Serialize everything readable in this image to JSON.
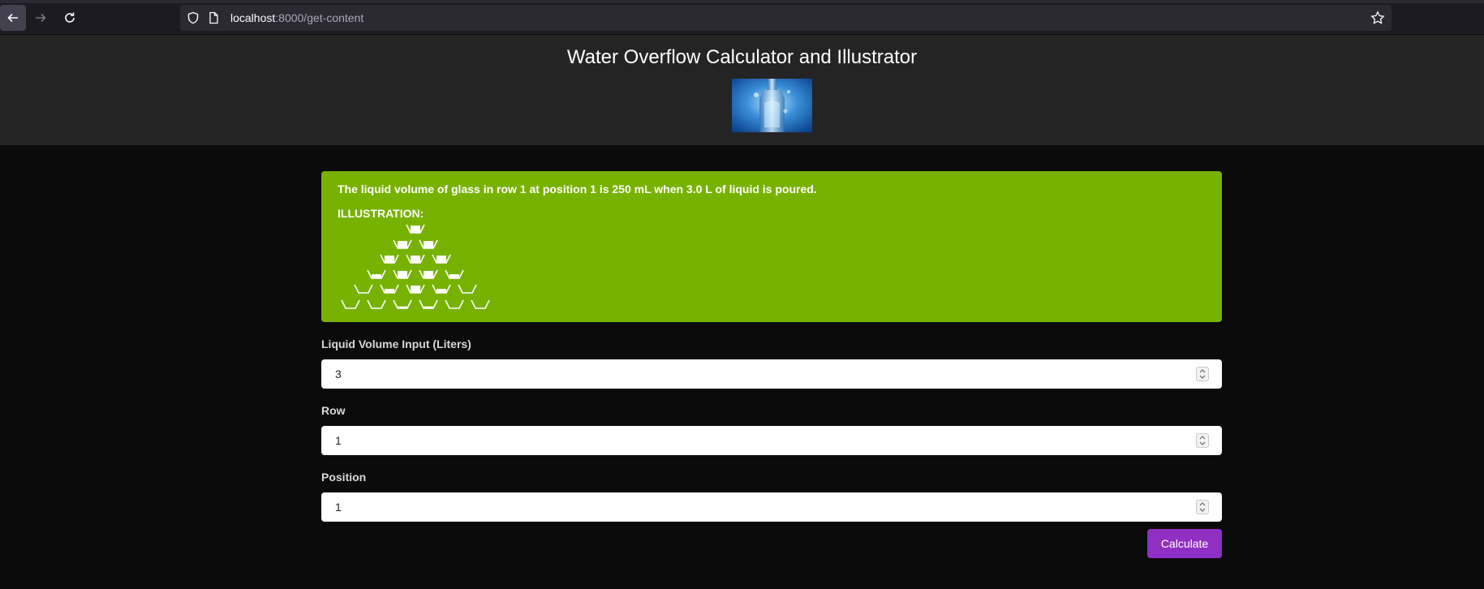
{
  "browser": {
    "url_host": "localhost",
    "url_rest": ":8000/get-content"
  },
  "header": {
    "title": "Water Overflow Calculator and Illustrator"
  },
  "result": {
    "message": "The liquid volume of glass in row 1 at position 1 is 250 mL when 3.0 L of liquid is poured.",
    "illustration_label": "ILLUSTRATION:",
    "pyramid_rows": [
      [
        "full"
      ],
      [
        "full",
        "full"
      ],
      [
        "full",
        "full",
        "full"
      ],
      [
        "partial",
        "full",
        "full",
        "partial"
      ],
      [
        "empty",
        "partial",
        "full",
        "partial",
        "empty"
      ],
      [
        "empty",
        "empty",
        "low",
        "low",
        "empty",
        "empty"
      ]
    ]
  },
  "form": {
    "volume_label": "Liquid Volume Input (Liters)",
    "volume_value": "3",
    "row_label": "Row",
    "row_value": "1",
    "position_label": "Position",
    "position_value": "1",
    "calculate_label": "Calculate"
  },
  "colors": {
    "result_bg": "#78b200",
    "button_bg": "#8f2fc4",
    "header_bg": "#242424",
    "page_bg": "#0b0b0b"
  }
}
